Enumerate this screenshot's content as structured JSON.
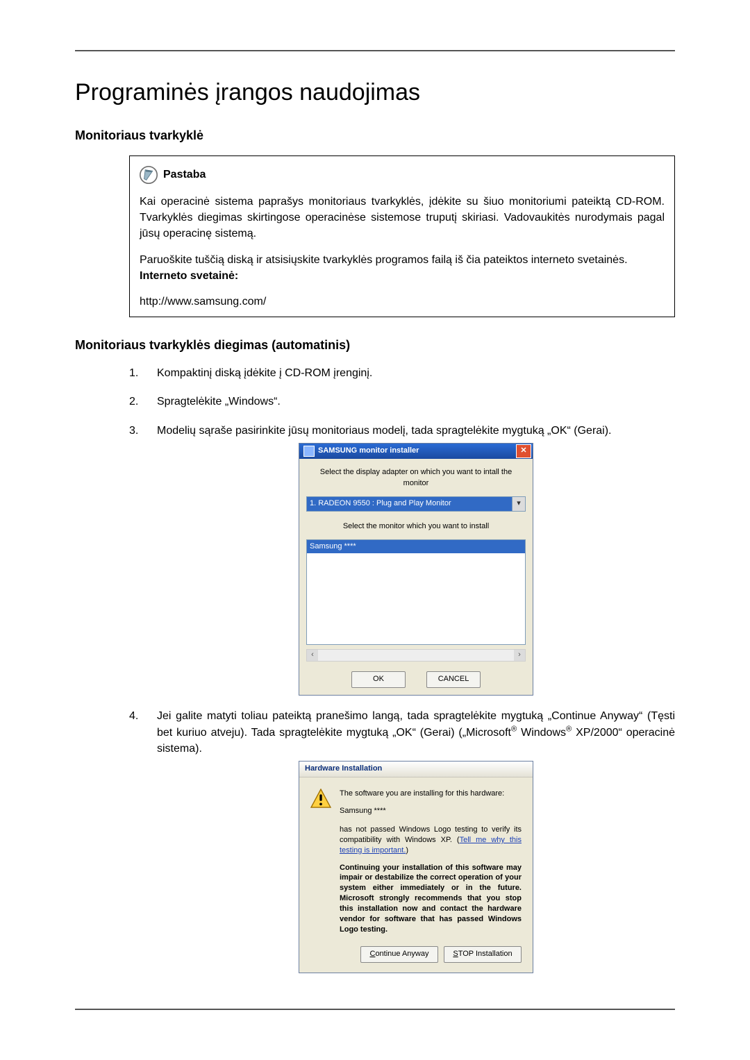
{
  "title": "Programinės įrangos naudojimas",
  "section1": {
    "heading": "Monitoriaus tvarkyklė",
    "note_label": "Pastaba",
    "note_p1": "Kai operacinė sistema paprašys monitoriaus tvarkyklės, įdėkite su šiuo monitoriumi pateiktą CD-ROM. Tvarkyklės diegimas skirtingose operacinėse sistemose truputį skiriasi. Vadovaukitės nurodymais pagal jūsų operacinę sistemą.",
    "note_p2": "Paruoškite tuščią diską ir atsisiųskite tvarkyklės programos failą iš čia pateiktos interneto svetainės.",
    "note_site_label": "Interneto svetainė:",
    "note_url": "http://www.samsung.com/"
  },
  "section2": {
    "heading": "Monitoriaus tvarkyklės diegimas (automatinis)",
    "steps": {
      "s1": "Kompaktinį diską įdėkite į CD-ROM įrenginį.",
      "s2": "Spragtelėkite „Windows“.",
      "s3": "Modelių sąraše pasirinkite jūsų monitoriaus modelį, tada spragtelėkite mygtuką „OK“ (Gerai).",
      "s4_pre": "Jei galite matyti toliau pateiktą pranešimo langą, tada spragtelėkite mygtuką „Continue Anyway“ (Tęsti bet kuriuo atveju). Tada spragtelėkite mygtuką „OK“ (Gerai) („Microsoft",
      "s4_reg1": "®",
      "s4_mid": " Windows",
      "s4_reg2": "®",
      "s4_post": " XP/2000“ operacinė sistema)."
    }
  },
  "installer": {
    "title": "SAMSUNG monitor installer",
    "sub1": "Select the display adapter on which you want to intall the monitor",
    "combo_value": "1. RADEON 9550 : Plug and Play Monitor",
    "sub2": "Select the monitor which you want to install",
    "list_item": "Samsung ****",
    "ok": "OK",
    "cancel": "CANCEL"
  },
  "hw": {
    "title": "Hardware Installation",
    "p1": "The software you are installing for this hardware:",
    "device": "Samsung ****",
    "p2a": "has not passed Windows Logo testing to verify its compatibility with Windows XP. (",
    "p2link": "Tell me why this testing is important.",
    "p2b": ")",
    "p3": "Continuing your installation of this software may impair or destabilize the correct operation of your system either immediately or in the future. Microsoft strongly recommends that you stop this installation now and contact the hardware vendor for software that has passed Windows Logo testing.",
    "btn_continue_u": "C",
    "btn_continue_rest": "ontinue Anyway",
    "btn_stop_u": "S",
    "btn_stop_rest": "TOP Installation"
  }
}
